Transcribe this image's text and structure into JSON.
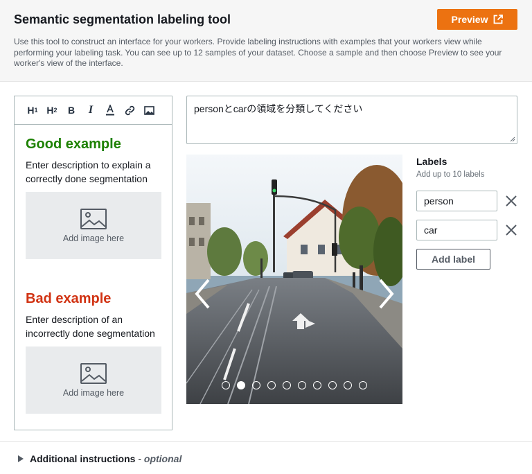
{
  "header": {
    "title": "Semantic segmentation labeling tool",
    "preview_label": "Preview",
    "description": "Use this tool to construct an interface for your workers. Provide labeling instructions with examples that your workers view while performing your labeling task. You can see up to 12 samples of your dataset. Choose a sample and then choose Preview to see your worker's view of the interface."
  },
  "editor": {
    "toolbar": [
      "heading-1",
      "heading-2",
      "bold",
      "italic",
      "text-color",
      "link",
      "image"
    ],
    "good": {
      "heading": "Good example",
      "text": "Enter description to explain a correctly done segmentation",
      "image_placeholder": "Add image here"
    },
    "bad": {
      "heading": "Bad example",
      "text": "Enter description of an incorrectly done segmentation",
      "image_placeholder": "Add image here"
    }
  },
  "instructions": {
    "value": "personとcarの領域を分類してください"
  },
  "carousel": {
    "sample_count": 10,
    "active_index": 1
  },
  "labels": {
    "title": "Labels",
    "subtitle": "Add up to 10 labels",
    "items": [
      "person",
      "car"
    ],
    "add_label": "Add label"
  },
  "footer": {
    "section": "Additional instructions",
    "suffix": "optional",
    "separator": " - "
  },
  "colors": {
    "accent": "#ec7211",
    "good": "#1d8102",
    "bad": "#d13212"
  }
}
